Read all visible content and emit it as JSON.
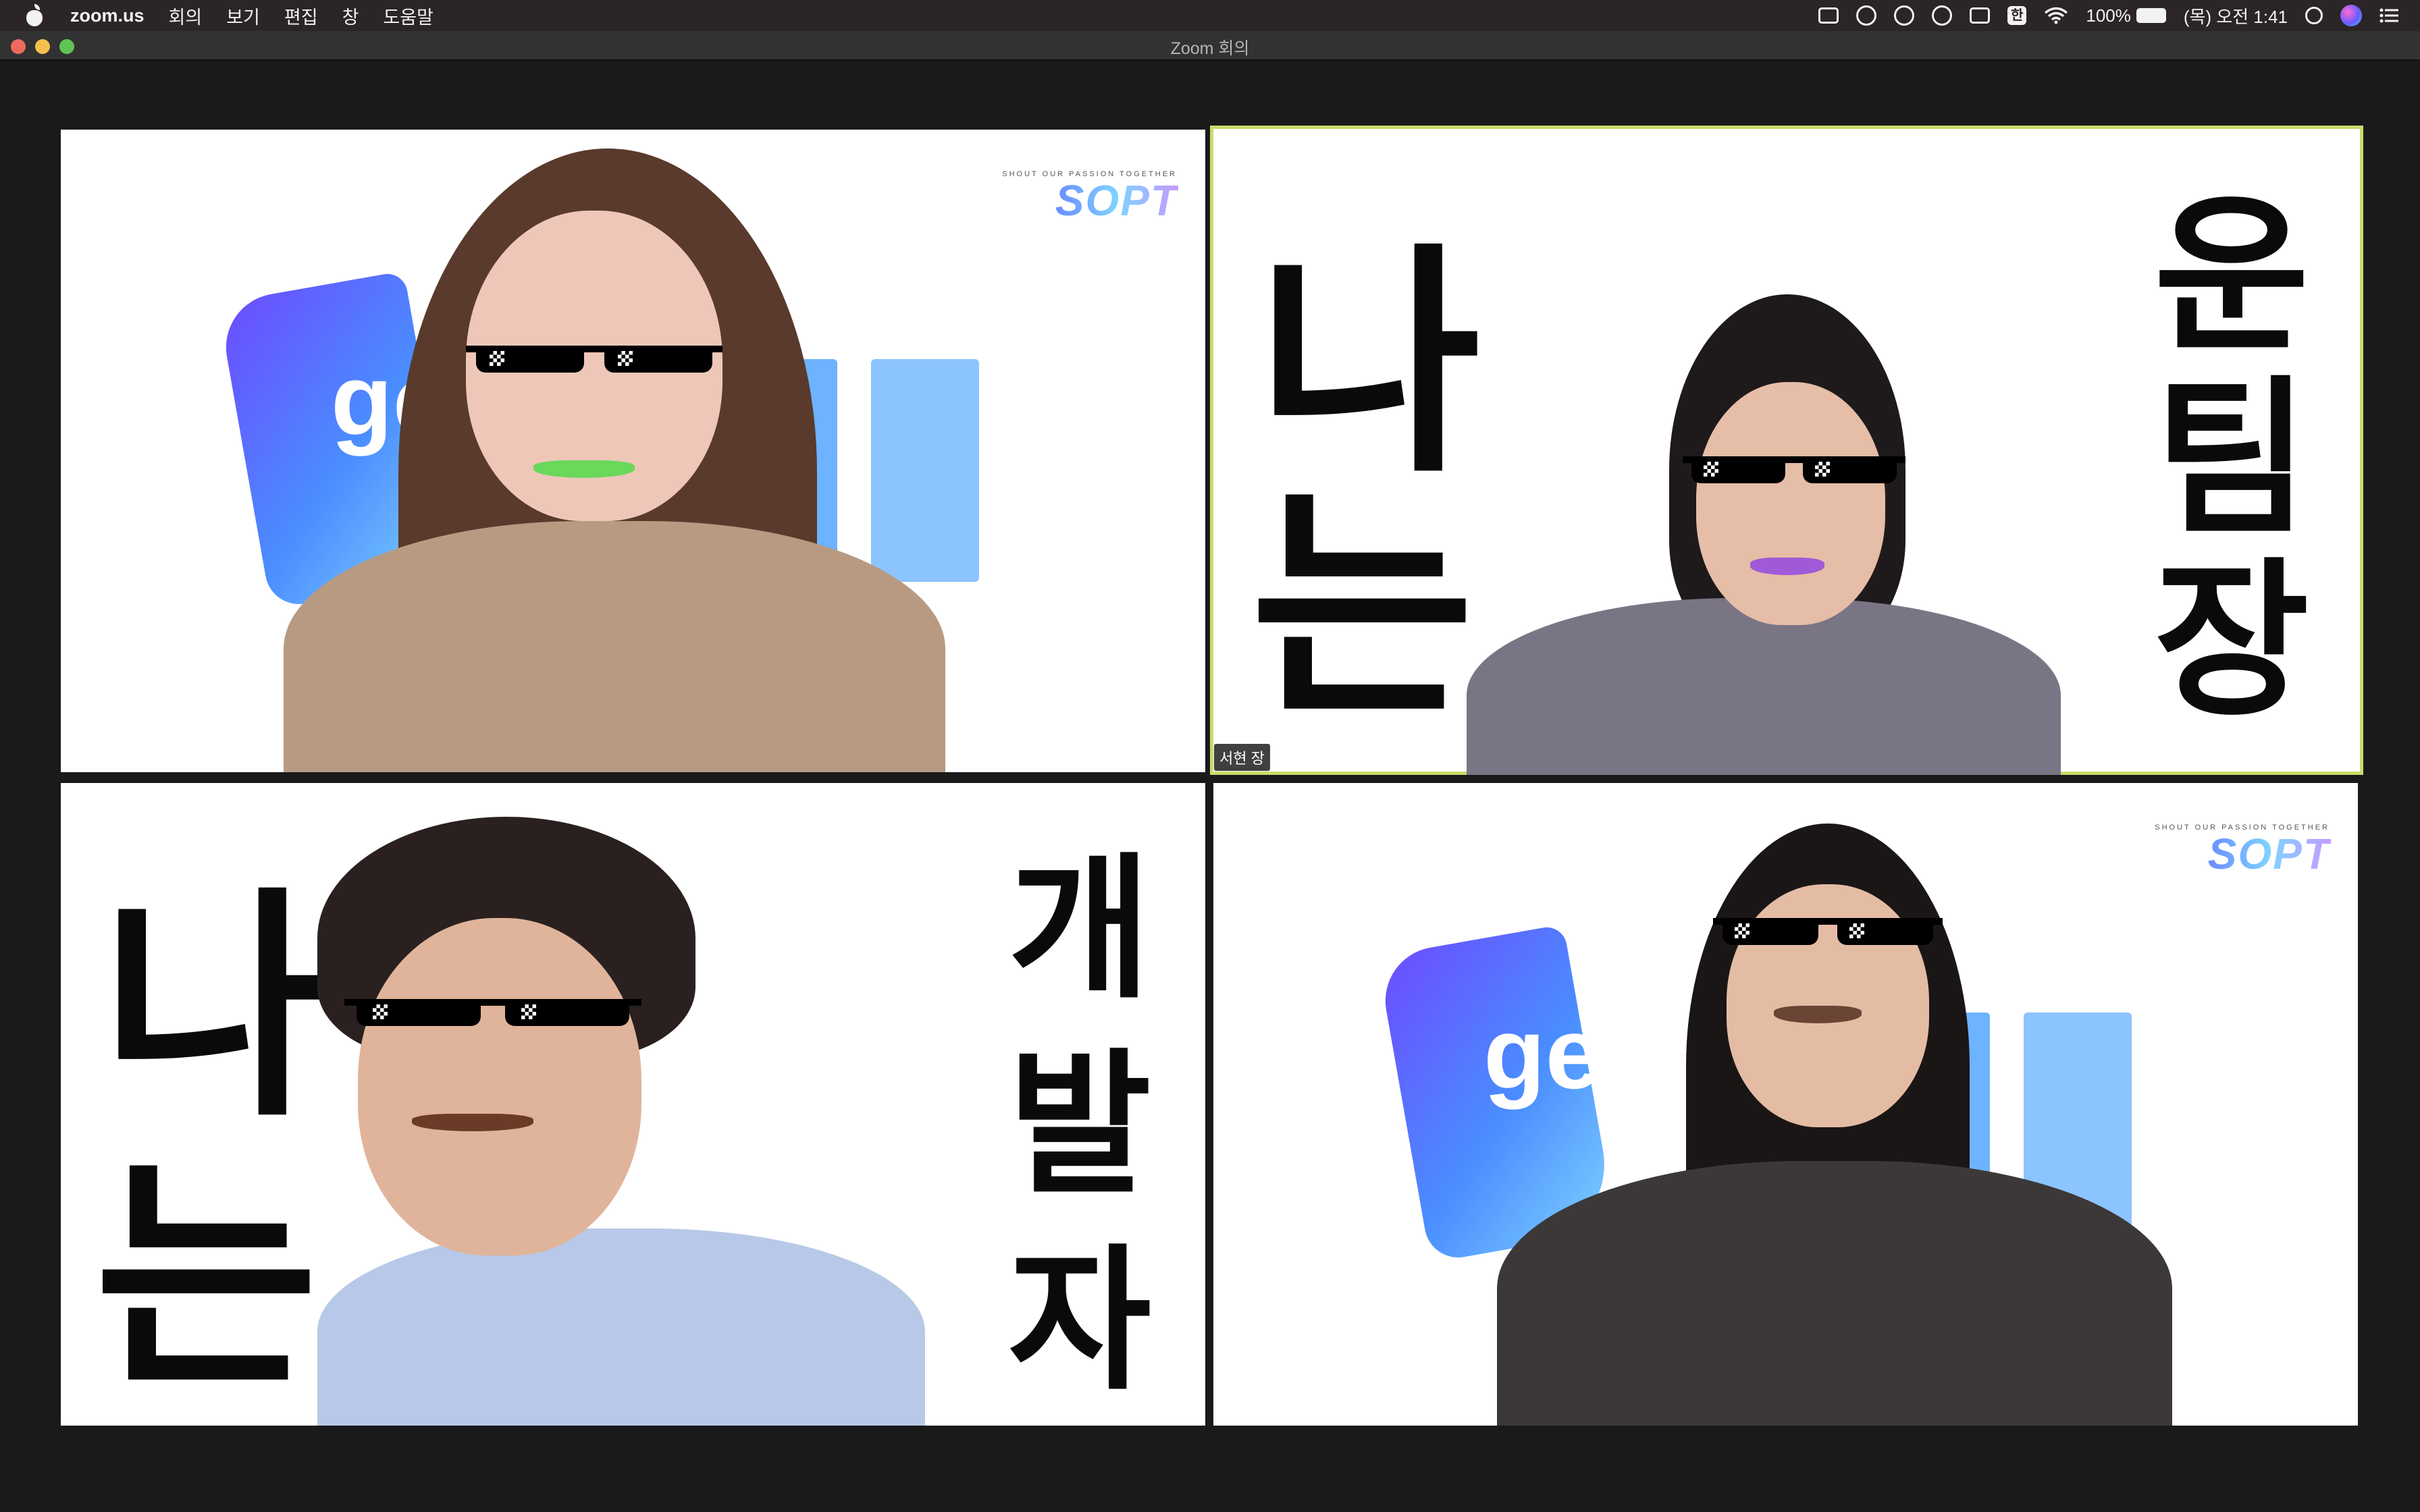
{
  "menubar": {
    "app_name": "zoom.us",
    "items": [
      "회의",
      "보기",
      "편집",
      "창",
      "도움말"
    ],
    "battery": "100%",
    "ime": "한",
    "clock": "(목) 오전 1:41"
  },
  "window": {
    "title": "Zoom 회의"
  },
  "gallery": {
    "tiles": [
      {
        "background_logo": "SOPT",
        "background_title": "gem",
        "active": false
      },
      {
        "name": "서현 장",
        "left_text": [
          "나",
          "는"
        ],
        "right_text": [
          "운",
          "팀",
          "장"
        ],
        "active": true
      },
      {
        "left_text": [
          "나",
          "는"
        ],
        "right_text": [
          "개",
          "발",
          "자"
        ],
        "active": false
      },
      {
        "background_logo": "SOPT",
        "background_title": "gem",
        "active": false
      }
    ]
  },
  "colors": {
    "active_speaker_border": "#c9dc6a",
    "menubar_bg": "#2b2527",
    "gallery_bg": "#1a1a1a"
  }
}
